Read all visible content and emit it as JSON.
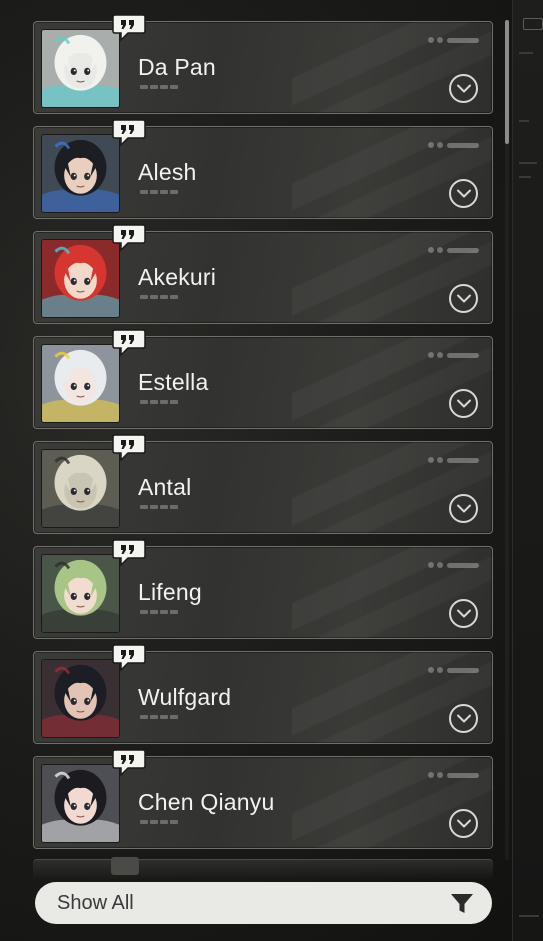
{
  "roster": {
    "characters": [
      {
        "name": "Da Pan",
        "bg": "#a9adab",
        "hair": "#f1f1ee",
        "skin": "#e9e9e6",
        "accent": "#4fd4d6",
        "icon": "panda-portrait"
      },
      {
        "name": "Alesh",
        "bg": "#404a55",
        "hair": "#1d1d24",
        "skin": "#e9cfbe",
        "accent": "#3d74d6",
        "icon": "alesh-portrait"
      },
      {
        "name": "Akekuri",
        "bg": "#8a2a2a",
        "hair": "#d63530",
        "skin": "#f1d8c8",
        "accent": "#4ec6d8",
        "icon": "akekuri-portrait"
      },
      {
        "name": "Estella",
        "bg": "#8d949c",
        "hair": "#e8ecef",
        "skin": "#f3e6e0",
        "accent": "#f3d03a",
        "icon": "estella-portrait"
      },
      {
        "name": "Antal",
        "bg": "#5e5d54",
        "hair": "#d9d6c6",
        "skin": "#c9c5b2",
        "accent": "#2d2d2d",
        "icon": "antal-portrait"
      },
      {
        "name": "Lifeng",
        "bg": "#495648",
        "hair": "#a8c486",
        "skin": "#f1ddd0",
        "accent": "#2b2f2a",
        "icon": "lifeng-portrait"
      },
      {
        "name": "Wulfgard",
        "bg": "#3a2f33",
        "hair": "#1c1d25",
        "skin": "#e3c3b4",
        "accent": "#a32b37",
        "icon": "wulfgard-portrait"
      },
      {
        "name": "Chen Qianyu",
        "bg": "#4d4f55",
        "hair": "#1b1b20",
        "skin": "#f1dad0",
        "accent": "#e8e8e8",
        "icon": "chen-qianyu-portrait"
      }
    ]
  },
  "filter": {
    "label": "Show All",
    "icon": "funnel-icon"
  },
  "colors": {
    "card_border": "#6f6f6b",
    "name_text": "#f2f2ef",
    "filter_bg": "#e9e9e6",
    "filter_text": "#3a3a38"
  }
}
